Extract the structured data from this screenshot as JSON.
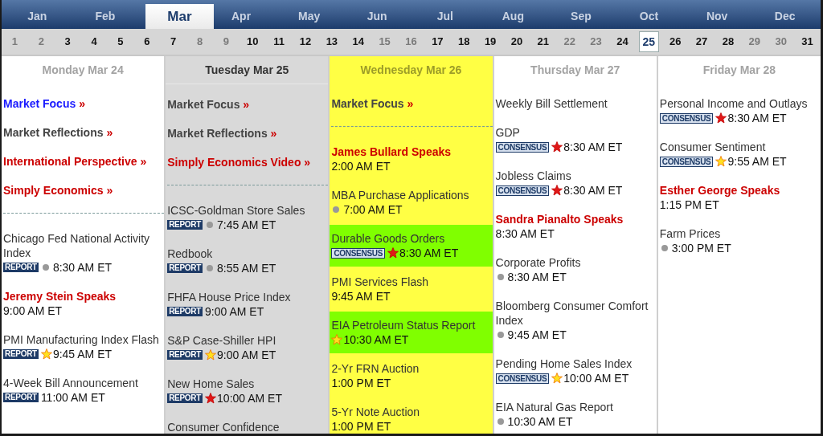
{
  "months": [
    {
      "label": "Jan",
      "selected": false
    },
    {
      "label": "Feb",
      "selected": false
    },
    {
      "label": "Mar",
      "selected": true
    },
    {
      "label": "Apr",
      "selected": false
    },
    {
      "label": "May",
      "selected": false
    },
    {
      "label": "Jun",
      "selected": false
    },
    {
      "label": "Jul",
      "selected": false
    },
    {
      "label": "Aug",
      "selected": false
    },
    {
      "label": "Sep",
      "selected": false
    },
    {
      "label": "Oct",
      "selected": false
    },
    {
      "label": "Nov",
      "selected": false
    },
    {
      "label": "Dec",
      "selected": false
    }
  ],
  "days": [
    {
      "label": "1",
      "dimmed": true,
      "selected": false
    },
    {
      "label": "2",
      "dimmed": true,
      "selected": false
    },
    {
      "label": "3",
      "dimmed": false,
      "selected": false
    },
    {
      "label": "4",
      "dimmed": false,
      "selected": false
    },
    {
      "label": "5",
      "dimmed": false,
      "selected": false
    },
    {
      "label": "6",
      "dimmed": false,
      "selected": false
    },
    {
      "label": "7",
      "dimmed": false,
      "selected": false
    },
    {
      "label": "8",
      "dimmed": true,
      "selected": false
    },
    {
      "label": "9",
      "dimmed": true,
      "selected": false
    },
    {
      "label": "10",
      "dimmed": false,
      "selected": false
    },
    {
      "label": "11",
      "dimmed": false,
      "selected": false
    },
    {
      "label": "12",
      "dimmed": false,
      "selected": false
    },
    {
      "label": "13",
      "dimmed": false,
      "selected": false
    },
    {
      "label": "14",
      "dimmed": false,
      "selected": false
    },
    {
      "label": "15",
      "dimmed": true,
      "selected": false
    },
    {
      "label": "16",
      "dimmed": true,
      "selected": false
    },
    {
      "label": "17",
      "dimmed": false,
      "selected": false
    },
    {
      "label": "18",
      "dimmed": false,
      "selected": false
    },
    {
      "label": "19",
      "dimmed": false,
      "selected": false
    },
    {
      "label": "20",
      "dimmed": false,
      "selected": false
    },
    {
      "label": "21",
      "dimmed": false,
      "selected": false
    },
    {
      "label": "22",
      "dimmed": true,
      "selected": false
    },
    {
      "label": "23",
      "dimmed": true,
      "selected": false
    },
    {
      "label": "24",
      "dimmed": false,
      "selected": false
    },
    {
      "label": "25",
      "dimmed": false,
      "selected": true
    },
    {
      "label": "26",
      "dimmed": false,
      "selected": false
    },
    {
      "label": "27",
      "dimmed": false,
      "selected": false
    },
    {
      "label": "28",
      "dimmed": false,
      "selected": false
    },
    {
      "label": "29",
      "dimmed": true,
      "selected": false
    },
    {
      "label": "30",
      "dimmed": true,
      "selected": false
    },
    {
      "label": "31",
      "dimmed": false,
      "selected": false
    }
  ],
  "columns": [
    {
      "header": "Monday Mar 24",
      "today": false,
      "selected": false,
      "links": [
        {
          "label": "Market Focus",
          "arrow": "»",
          "color": "#1a1aff"
        },
        {
          "label": "Market Reflections",
          "arrow": "»",
          "color": "#444444"
        },
        {
          "label": "International Perspective",
          "arrow": "»",
          "color": "#cc0000"
        },
        {
          "label": "Simply Economics",
          "arrow": "»",
          "color": "#cc0000"
        }
      ],
      "events": [
        {
          "title": "Chicago Fed National Activity Index",
          "speaker": false,
          "badge": {
            "text": "REPORT",
            "kind": "report"
          },
          "marker": {
            "kind": "low"
          },
          "time": "8:30 AM ET",
          "highlighted": false
        },
        {
          "title": "Jeremy Stein Speaks",
          "speaker": true,
          "time": "9:00 AM ET",
          "highlighted": false
        },
        {
          "title": "PMI Manufacturing Index Flash",
          "speaker": false,
          "badge": {
            "text": "REPORT",
            "kind": "report"
          },
          "marker": {
            "kind": "medium"
          },
          "time": "9:45 AM ET",
          "highlighted": false
        },
        {
          "title": "4-Week Bill Announcement",
          "speaker": false,
          "badge": {
            "text": "REPORT",
            "kind": "report"
          },
          "time": "11:00 AM ET",
          "highlighted": false
        }
      ]
    },
    {
      "header": "Tuesday Mar 25",
      "today": true,
      "selected": false,
      "links": [
        {
          "label": "Market Focus",
          "arrow": "»",
          "color": "#444444"
        },
        {
          "label": "Market Reflections",
          "arrow": "»",
          "color": "#444444"
        },
        {
          "label": "Simply Economics Video",
          "arrow": "»",
          "color": "#cc0000"
        }
      ],
      "events": [
        {
          "title": "ICSC-Goldman Store Sales",
          "speaker": false,
          "badge": {
            "text": "REPORT",
            "kind": "report"
          },
          "marker": {
            "kind": "low"
          },
          "time": "7:45 AM ET",
          "highlighted": false
        },
        {
          "title": "Redbook",
          "speaker": false,
          "badge": {
            "text": "REPORT",
            "kind": "report"
          },
          "marker": {
            "kind": "low"
          },
          "time": "8:55 AM ET",
          "highlighted": false
        },
        {
          "title": "FHFA House Price Index",
          "speaker": false,
          "badge": {
            "text": "REPORT",
            "kind": "report"
          },
          "time": "9:00 AM ET",
          "highlighted": false
        },
        {
          "title": "S&P Case-Shiller HPI",
          "speaker": false,
          "badge": {
            "text": "REPORT",
            "kind": "report"
          },
          "marker": {
            "kind": "medium"
          },
          "time": "9:00 AM ET",
          "highlighted": false
        },
        {
          "title": "New Home Sales",
          "speaker": false,
          "badge": {
            "text": "REPORT",
            "kind": "report"
          },
          "marker": {
            "kind": "high"
          },
          "time": "10:00 AM ET",
          "highlighted": false
        },
        {
          "title": "Consumer Confidence",
          "speaker": false,
          "highlighted": false
        }
      ]
    },
    {
      "header": "Wednesday Mar 26",
      "today": false,
      "selected": true,
      "links": [
        {
          "label": "Market Focus",
          "arrow": "»",
          "color": "#444444"
        }
      ],
      "events": [
        {
          "title": "James Bullard Speaks",
          "speaker": true,
          "time": "2:00 AM ET",
          "highlighted": false
        },
        {
          "title": "MBA Purchase Applications",
          "speaker": false,
          "marker": {
            "kind": "low"
          },
          "time": "7:00 AM ET",
          "highlighted": false
        },
        {
          "title": "Durable Goods Orders",
          "speaker": false,
          "badge": {
            "text": "CONSENSUS",
            "kind": "consensus"
          },
          "marker": {
            "kind": "high"
          },
          "time": "8:30 AM ET",
          "highlighted": true
        },
        {
          "title": "PMI Services Flash",
          "speaker": false,
          "time": "9:45 AM ET",
          "highlighted": false
        },
        {
          "title": "EIA Petroleum Status Report",
          "speaker": false,
          "marker": {
            "kind": "medium"
          },
          "time": "10:30 AM ET",
          "highlighted": true
        },
        {
          "title": "2-Yr FRN Auction",
          "speaker": false,
          "time": "1:00 PM ET",
          "highlighted": false
        },
        {
          "title": "5-Yr Note Auction",
          "speaker": false,
          "time": "1:00 PM ET",
          "highlighted": false
        }
      ]
    },
    {
      "header": "Thursday Mar 27",
      "today": false,
      "selected": false,
      "events": [
        {
          "title": "Weekly Bill Settlement",
          "speaker": false,
          "highlighted": false
        },
        {
          "title": "GDP",
          "speaker": false,
          "badge": {
            "text": "CONSENSUS",
            "kind": "consensus"
          },
          "marker": {
            "kind": "high"
          },
          "time": "8:30 AM ET",
          "highlighted": false
        },
        {
          "title": "Jobless Claims",
          "speaker": false,
          "badge": {
            "text": "CONSENSUS",
            "kind": "consensus"
          },
          "marker": {
            "kind": "high"
          },
          "time": "8:30 AM ET",
          "highlighted": false
        },
        {
          "title": "Sandra Pianalto Speaks",
          "speaker": true,
          "time": "8:30 AM ET",
          "highlighted": false
        },
        {
          "title": "Corporate Profits",
          "speaker": false,
          "marker": {
            "kind": "low"
          },
          "time": "8:30 AM ET",
          "highlighted": false
        },
        {
          "title": "Bloomberg Consumer Comfort Index",
          "speaker": false,
          "marker": {
            "kind": "low"
          },
          "time": "9:45 AM ET",
          "highlighted": false
        },
        {
          "title": "Pending Home Sales Index",
          "speaker": false,
          "badge": {
            "text": "CONSENSUS",
            "kind": "consensus"
          },
          "marker": {
            "kind": "medium"
          },
          "time": "10:00 AM ET",
          "highlighted": false
        },
        {
          "title": "EIA Natural Gas Report",
          "speaker": false,
          "marker": {
            "kind": "low"
          },
          "time": "10:30 AM ET",
          "highlighted": false
        }
      ]
    },
    {
      "header": "Friday Mar 28",
      "today": false,
      "selected": false,
      "events": [
        {
          "title": "Personal Income and Outlays",
          "speaker": false,
          "badge": {
            "text": "CONSENSUS",
            "kind": "consensus"
          },
          "marker": {
            "kind": "high"
          },
          "time": "8:30 AM ET",
          "highlighted": false
        },
        {
          "title": "Consumer Sentiment",
          "speaker": false,
          "badge": {
            "text": "CONSENSUS",
            "kind": "consensus"
          },
          "marker": {
            "kind": "medium"
          },
          "time": "9:55 AM ET",
          "highlighted": false
        },
        {
          "title": "Esther George Speaks",
          "speaker": true,
          "time": "1:15 PM ET",
          "highlighted": false
        },
        {
          "title": "Farm Prices",
          "speaker": false,
          "marker": {
            "kind": "low"
          },
          "time": "3:00 PM ET",
          "highlighted": false
        }
      ]
    }
  ]
}
